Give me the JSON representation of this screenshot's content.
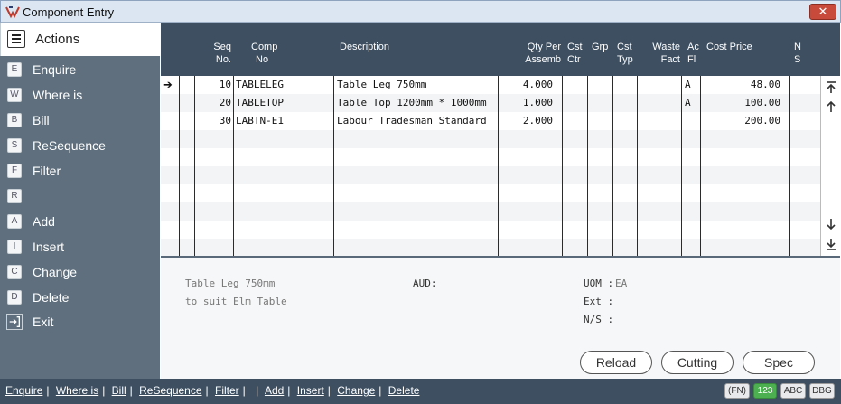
{
  "window": {
    "title": "Component Entry",
    "close_glyph": "✕"
  },
  "sidebar": {
    "header": "Actions",
    "items": [
      {
        "key": "E",
        "label": "Enquire"
      },
      {
        "key": "W",
        "label": "Where is"
      },
      {
        "key": "B",
        "label": "Bill"
      },
      {
        "key": "S",
        "label": "ReSequence"
      },
      {
        "key": "F",
        "label": "Filter"
      },
      {
        "key": "R",
        "label": ""
      },
      {
        "key": "A",
        "label": "Add"
      },
      {
        "key": "I",
        "label": "Insert"
      },
      {
        "key": "C",
        "label": "Change"
      },
      {
        "key": "D",
        "label": "Delete"
      },
      {
        "key": "",
        "label": "Exit"
      }
    ]
  },
  "grid": {
    "headers": {
      "seq": [
        "Seq",
        "No."
      ],
      "comp": [
        "Comp",
        "No"
      ],
      "desc": "Description",
      "qty": [
        "Qty Per",
        "Assemb"
      ],
      "cstctr": [
        "Cst",
        "Ctr"
      ],
      "grp": "Grp",
      "csttyp": [
        "Cst",
        "Typ"
      ],
      "waste": [
        "Waste",
        "Fact"
      ],
      "acfl": [
        "Ac",
        "Fl"
      ],
      "cost": "Cost Price",
      "ns": [
        "N",
        "S"
      ]
    },
    "rows": [
      {
        "seq": "10",
        "comp": "TABLELEG",
        "desc": "Table Leg 750mm",
        "qty": "4.000",
        "acfl": "A",
        "cost": "48.00",
        "selected": true
      },
      {
        "seq": "20",
        "comp": "TABLETOP",
        "desc": "Table Top 1200mm * 1000mm",
        "qty": "1.000",
        "acfl": "A",
        "cost": "100.00"
      },
      {
        "seq": "30",
        "comp": "LABTN-E1",
        "desc": "Labour Tradesman Standard",
        "qty": "2.000",
        "acfl": "",
        "cost": "200.00"
      }
    ],
    "pointer": "➔"
  },
  "detail": {
    "line1": "Table Leg 750mm",
    "line2": "to suit Elm Table",
    "aud_label": "AUD:",
    "uom_label": "UOM :",
    "uom_value": "EA",
    "ext_label": "Ext :",
    "ns_label": "N/S :"
  },
  "buttons": {
    "reload": "Reload",
    "cutting": "Cutting",
    "spec": "Spec"
  },
  "statusbar": {
    "links": [
      "Enquire",
      "Where is",
      "Bill",
      "ReSequence",
      "Filter",
      "",
      "Add",
      "Insert",
      "Change",
      "Delete"
    ],
    "badges": {
      "fn": "(FN)",
      "num": "123",
      "abc": "ABC",
      "dbg": "DBG"
    }
  },
  "colors": {
    "sidebar": "#5f6f7d",
    "header": "#3d4f61",
    "close": "#c84a3b",
    "num_badge": "#4caf50"
  }
}
